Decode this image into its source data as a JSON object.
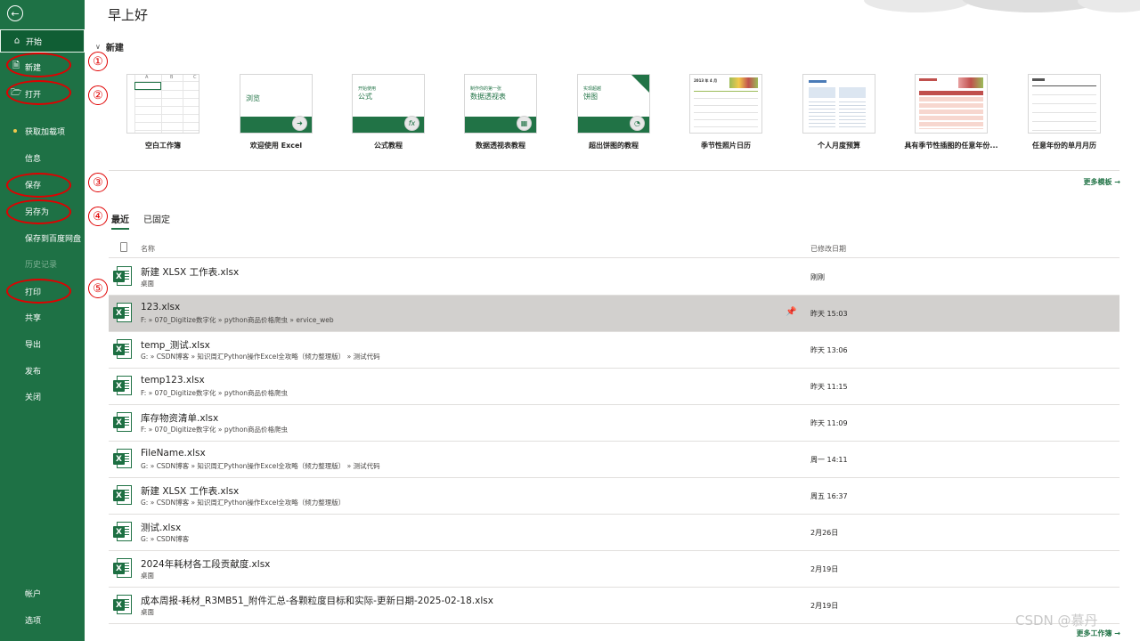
{
  "sidebar": {
    "back_icon": "back-arrow-icon",
    "items": [
      {
        "label": "开始",
        "icon": "home-icon",
        "active": true
      },
      {
        "label": "新建",
        "icon": "new-file-icon"
      },
      {
        "label": "打开",
        "icon": "folder-open-icon"
      },
      {
        "label": "获取加载项",
        "icon": "dot"
      },
      {
        "label": "信息"
      },
      {
        "label": "保存"
      },
      {
        "label": "另存为"
      },
      {
        "label": "保存到百度网盘"
      },
      {
        "label": "历史记录",
        "disabled": true
      },
      {
        "label": "打印"
      },
      {
        "label": "共享"
      },
      {
        "label": "导出"
      },
      {
        "label": "发布"
      },
      {
        "label": "关闭"
      }
    ],
    "bottom_items": [
      {
        "label": "帐户"
      },
      {
        "label": "选项"
      }
    ]
  },
  "main": {
    "greeting": "早上好",
    "new_section": {
      "title": "新建",
      "templates": [
        {
          "label": "空白工作簿"
        },
        {
          "label": "欢迎使用 Excel",
          "thumb_text": "浏览"
        },
        {
          "label": "公式教程",
          "thumb_sub": "开始使用",
          "thumb_text": "公式"
        },
        {
          "label": "数据透视表教程",
          "thumb_sub": "制作你的第一张",
          "thumb_text": "数据透视表"
        },
        {
          "label": "超出饼图的教程",
          "thumb_sub": "实现超越",
          "thumb_text": "饼图"
        },
        {
          "label": "季节性照片日历",
          "thumb_text": "2013 年 4 月"
        },
        {
          "label": "个人月度预算"
        },
        {
          "label": "具有季节性插图的任意年份..."
        },
        {
          "label": "任意年份的单月月历"
        }
      ],
      "more_label": "更多模板 →"
    },
    "tabs": [
      {
        "label": "最近",
        "active": true
      },
      {
        "label": "已固定"
      }
    ],
    "list_header": {
      "name": "名称",
      "date": "已修改日期"
    },
    "files": [
      {
        "name": "新建 XLSX 工作表.xlsx",
        "path": "桌面",
        "date": "刚刚"
      },
      {
        "name": "123.xlsx",
        "path": "F: » 070_Digitize数字化 » python商品价格爬虫 » ervice_web",
        "date": "昨天 15:03",
        "highlight": true
      },
      {
        "name": "temp_测试.xlsx",
        "path": "G: » CSDN博客 » 知识周汇Python操作Excel全攻略（倾力整理版） » 测试代码",
        "date": "昨天 13:06"
      },
      {
        "name": "temp123.xlsx",
        "path": "F: » 070_Digitize数字化 » python商品价格爬虫",
        "date": "昨天 11:15"
      },
      {
        "name": "库存物资清单.xlsx",
        "path": "F: » 070_Digitize数字化 » python商品价格爬虫",
        "date": "昨天 11:09"
      },
      {
        "name": "FileName.xlsx",
        "path": "G: » CSDN博客 » 知识周汇Python操作Excel全攻略（倾力整理版） » 测试代码",
        "date": "周一 14:11"
      },
      {
        "name": "新建 XLSX 工作表.xlsx",
        "path": "G: » CSDN博客 » 知识周汇Python操作Excel全攻略（倾力整理版）",
        "date": "周五 16:37"
      },
      {
        "name": "测试.xlsx",
        "path": "G: » CSDN博客",
        "date": "2月26日"
      },
      {
        "name": "2024年耗材各工段贡献度.xlsx",
        "path": "桌面",
        "date": "2月19日"
      },
      {
        "name": "成本周报-耗材_R3MB51_附件汇总-各颗粒度目标和实际-更新日期-2025-02-18.xlsx",
        "path": "桌面",
        "date": "2月19日"
      }
    ],
    "more_workbooks": "更多工作簿 →"
  },
  "annotations": [
    "①",
    "②",
    "③",
    "④",
    "⑤"
  ],
  "watermark": "CSDN @慕丹",
  "colors": {
    "accent": "#217346",
    "sidebar": "#1e7145",
    "annotation": "#e00000"
  }
}
